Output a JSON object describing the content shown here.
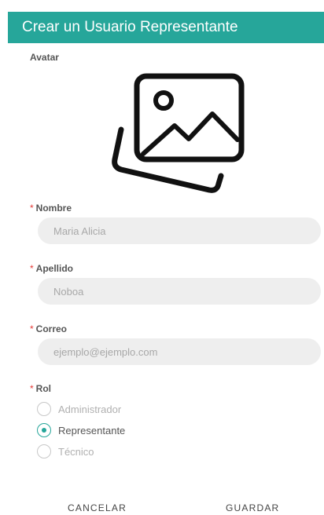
{
  "colors": {
    "accent": "#26a69a",
    "required": "#e53935"
  },
  "dialog": {
    "title": "Crear un Usuario Representante"
  },
  "form": {
    "avatar": {
      "label": "Avatar",
      "icon": "image-placeholder-icon"
    },
    "required_mark": "*",
    "nombre": {
      "label": "Nombre",
      "placeholder": "Maria Alicia"
    },
    "apellido": {
      "label": "Apellido",
      "placeholder": "Noboa"
    },
    "correo": {
      "label": "Correo",
      "placeholder": "ejemplo@ejemplo.com"
    },
    "rol": {
      "label": "Rol",
      "options": [
        {
          "label": "Administrador",
          "checked": false
        },
        {
          "label": "Representante",
          "checked": true
        },
        {
          "label": "Técnico",
          "checked": false
        }
      ]
    }
  },
  "actions": {
    "cancel": "CANCELAR",
    "save": "GUARDAR"
  }
}
